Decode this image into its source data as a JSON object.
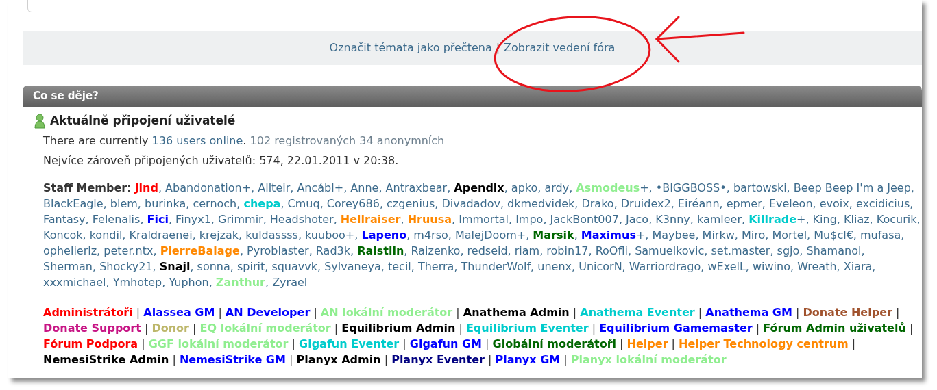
{
  "top_links": [
    {
      "label": "Označit témata jako přečtena"
    },
    {
      "label": "Zobrazit vedení fóra"
    }
  ],
  "top_links_separator": "|",
  "panel": {
    "title": "Co se děje?",
    "section_title": "Aktuálně připojení uživatelé",
    "online_summary": [
      {
        "kind": "plain",
        "text": "There are currently "
      },
      {
        "kind": "link",
        "text": "136 users online"
      },
      {
        "kind": "plain",
        "text": ". "
      },
      {
        "kind": "muted",
        "text": "102 registrovaných 34 anonymních"
      }
    ],
    "record": "Nejvíce zároveň připojených uživatelů: 574, 22.01.2011 v 20:38.",
    "staff_label": "Staff Member:",
    "users_separator": ", ",
    "users": [
      {
        "name": "Jind",
        "color": "#ff0000"
      },
      {
        "name": "Abandonation+"
      },
      {
        "name": "Allteir"
      },
      {
        "name": "Ancábl+"
      },
      {
        "name": "Anne"
      },
      {
        "name": "Antraxbear"
      },
      {
        "name": "Apendix",
        "color": "#000000"
      },
      {
        "name": "apko"
      },
      {
        "name": "ardy"
      },
      {
        "name": "Asmodeus",
        "color": "#90ee90",
        "suffix": "+"
      },
      {
        "name": "•BIGGBOSS•"
      },
      {
        "name": "bartowski"
      },
      {
        "name": "Beep Beep I'm a Jeep"
      },
      {
        "name": "BlackEagle"
      },
      {
        "name": "blem"
      },
      {
        "name": "burinka"
      },
      {
        "name": "cernoch"
      },
      {
        "name": "chepa",
        "color": "#00cccc"
      },
      {
        "name": "Cmuq"
      },
      {
        "name": "Corey686"
      },
      {
        "name": "czgenius"
      },
      {
        "name": "Divadadov"
      },
      {
        "name": "dkmedvidek"
      },
      {
        "name": "Drako"
      },
      {
        "name": "Druidex2"
      },
      {
        "name": "Eiréann"
      },
      {
        "name": "epmer"
      },
      {
        "name": "Eveleon"
      },
      {
        "name": "evoix"
      },
      {
        "name": "excidicius"
      },
      {
        "name": "Fantasy"
      },
      {
        "name": "Felenalis"
      },
      {
        "name": "Fici",
        "color": "#0000ff"
      },
      {
        "name": "Finyx1"
      },
      {
        "name": "Grimmir"
      },
      {
        "name": "Headshoter"
      },
      {
        "name": "Hellraiser",
        "color": "#ff8800"
      },
      {
        "name": "Hruusa",
        "color": "#ff8800"
      },
      {
        "name": "Immortal"
      },
      {
        "name": "Impo"
      },
      {
        "name": "JackBont007"
      },
      {
        "name": "Jaco"
      },
      {
        "name": "K3nny"
      },
      {
        "name": "kamleer"
      },
      {
        "name": "Killrade",
        "color": "#00cccc",
        "suffix": "+"
      },
      {
        "name": "King"
      },
      {
        "name": "Kliaz"
      },
      {
        "name": "Kocurik"
      },
      {
        "name": "Koncok"
      },
      {
        "name": "kondil"
      },
      {
        "name": "Kraldraenei"
      },
      {
        "name": "krejzak"
      },
      {
        "name": "kuldassss"
      },
      {
        "name": "kuuboo+"
      },
      {
        "name": "Lapeno",
        "color": "#0000ff"
      },
      {
        "name": "m4rso"
      },
      {
        "name": "MalejDoom+"
      },
      {
        "name": "Marsik",
        "color": "#006600"
      },
      {
        "name": "Maximus",
        "color": "#0000ff",
        "suffix": "+"
      },
      {
        "name": "Maybee"
      },
      {
        "name": "Mirkw"
      },
      {
        "name": "Miro"
      },
      {
        "name": "Mortel"
      },
      {
        "name": "Mu$cl€"
      },
      {
        "name": "mufasa"
      },
      {
        "name": "ophelierlz"
      },
      {
        "name": "peter.ntx"
      },
      {
        "name": "PierreBalage",
        "color": "#ff8800"
      },
      {
        "name": "Pyroblaster"
      },
      {
        "name": "Rad3k"
      },
      {
        "name": "Raistlin",
        "color": "#006600"
      },
      {
        "name": "Raizenko"
      },
      {
        "name": "redseid"
      },
      {
        "name": "riam"
      },
      {
        "name": "robin17"
      },
      {
        "name": "RoOfli"
      },
      {
        "name": "Samuelkovic"
      },
      {
        "name": "set.master"
      },
      {
        "name": "sgjo"
      },
      {
        "name": "Shamanol"
      },
      {
        "name": "Sherman"
      },
      {
        "name": "Shocky21"
      },
      {
        "name": "Snajl",
        "color": "#000000"
      },
      {
        "name": "sonna"
      },
      {
        "name": "spirit"
      },
      {
        "name": "squavvk"
      },
      {
        "name": "Sylvaneya"
      },
      {
        "name": "tecil"
      },
      {
        "name": "Therra"
      },
      {
        "name": "ThunderWolf"
      },
      {
        "name": "unenx"
      },
      {
        "name": "UnicorN"
      },
      {
        "name": "Warriordrago"
      },
      {
        "name": "wExelL"
      },
      {
        "name": "wiwino"
      },
      {
        "name": "Wreath"
      },
      {
        "name": "Xiara"
      },
      {
        "name": "xxxmichael"
      },
      {
        "name": "Ymhotep"
      },
      {
        "name": "Yuphon"
      },
      {
        "name": "Zanthur",
        "color": "#90ee90"
      },
      {
        "name": "Zyrael"
      }
    ],
    "groups_separator": " | ",
    "groups": [
      {
        "name": "Administrátoři",
        "color": "#ff0000"
      },
      {
        "name": "Alassea GM",
        "color": "#0000ff"
      },
      {
        "name": "AN Developer",
        "color": "#0000ff"
      },
      {
        "name": "AN lokální moderátor",
        "color": "#90ee90"
      },
      {
        "name": "Anathema Admin",
        "color": "#000000"
      },
      {
        "name": "Anathema Eventer",
        "color": "#00cccc"
      },
      {
        "name": "Anathema GM",
        "color": "#0000ff"
      },
      {
        "name": "Donate Helper",
        "color": "#a0522d"
      },
      {
        "name": "Donate Support",
        "color": "#c71585"
      },
      {
        "name": "Donor",
        "color": "#bdb76b"
      },
      {
        "name": "EQ lokální moderátor",
        "color": "#90ee90"
      },
      {
        "name": "Equilibrium Admin",
        "color": "#000000"
      },
      {
        "name": "Equilibrium Eventer",
        "color": "#00cccc"
      },
      {
        "name": "Equilibrium Gamemaster",
        "color": "#0000ff"
      },
      {
        "name": "Fórum Admin uživatelů",
        "color": "#006600"
      },
      {
        "name": "Fórum Podpora",
        "color": "#ff0000"
      },
      {
        "name": "GGF lokální moderátor",
        "color": "#90ee90"
      },
      {
        "name": "Gigafun Eventer",
        "color": "#00cccc"
      },
      {
        "name": "Gigafun GM",
        "color": "#0000ff"
      },
      {
        "name": "Globální moderátoři",
        "color": "#006600"
      },
      {
        "name": "Helper",
        "color": "#ff8800"
      },
      {
        "name": "Helper Technology centrum",
        "color": "#ff8800"
      },
      {
        "name": "NemesiStrike Admin",
        "color": "#000000"
      },
      {
        "name": "NemesiStrike GM",
        "color": "#0000ff"
      },
      {
        "name": "Planyx Admin",
        "color": "#000000"
      },
      {
        "name": "Planyx Eventer",
        "color": "#000080"
      },
      {
        "name": "Planyx GM",
        "color": "#0000ff"
      },
      {
        "name": "Planyx lokální moderátor",
        "color": "#90ee90"
      }
    ]
  }
}
